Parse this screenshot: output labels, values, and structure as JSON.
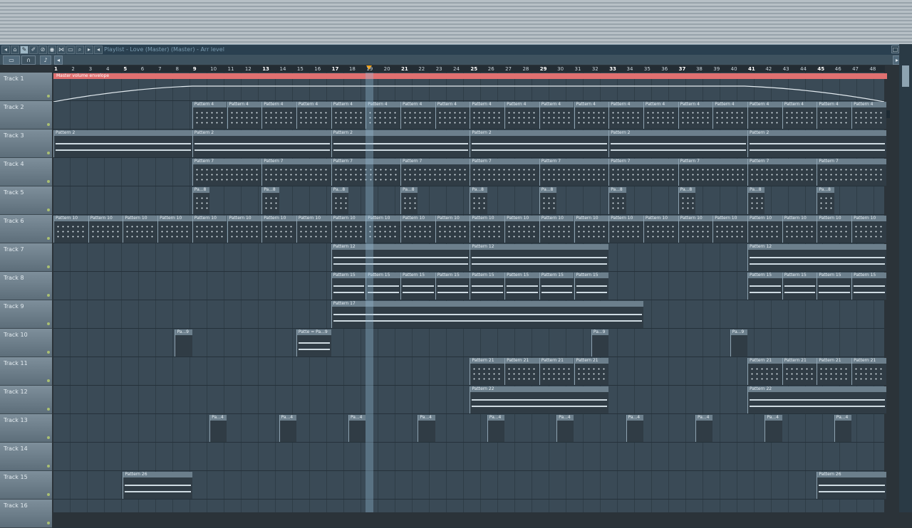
{
  "window": {
    "title": "Playlist - Love (Master) (Master) - Arr level"
  },
  "toolbar": {
    "icons": [
      "snap-icon",
      "pencil-icon",
      "brush-icon",
      "delete-icon",
      "mute-icon",
      "slice-icon",
      "select-icon",
      "zoom-icon",
      "playback-icon"
    ],
    "left_buttons": [
      "box-icon",
      "magnet-icon",
      "pattern-icon"
    ]
  },
  "ruler": {
    "numbers": [
      "1",
      "2",
      "3",
      "4",
      "5",
      "6",
      "7",
      "8",
      "9",
      "10",
      "11",
      "12",
      "13",
      "14",
      "15",
      "16",
      "17",
      "18",
      "19",
      "20",
      "21",
      "22",
      "23",
      "24",
      "25",
      "26",
      "27",
      "28",
      "29",
      "30",
      "31",
      "32",
      "33",
      "34",
      "35",
      "36",
      "37",
      "38",
      "39",
      "40",
      "41",
      "42",
      "43",
      "44",
      "45",
      "46",
      "47",
      "48"
    ]
  },
  "tracks": [
    "Track 1",
    "Track 2",
    "Track 3",
    "Track 4",
    "Track 5",
    "Track 6",
    "Track 7",
    "Track 8",
    "Track 9",
    "Track 10",
    "Track 11",
    "Track 12",
    "Track 13",
    "Track 14",
    "Track 15",
    "Track 16"
  ],
  "envelope": {
    "label": "Master volume envelope"
  },
  "clips": {
    "p4": "Pattern 4",
    "p2": "Pattern 2",
    "p7": "Pattern 7",
    "p8": "Pa...8",
    "p10": "Pattern 10",
    "p12": "Pattern 12",
    "p15": "Pattern 15",
    "p17": "Pattern 17",
    "p9": "Pa...9",
    "p9b": "Patte = Pa...9",
    "p21": "Pattern 21",
    "p22": "Pattern 22",
    "p4b": "Pa...4",
    "p26": "Pattern 26"
  },
  "colors": {
    "envelope": "#e07070",
    "playhead_marker": "#f2a218"
  }
}
